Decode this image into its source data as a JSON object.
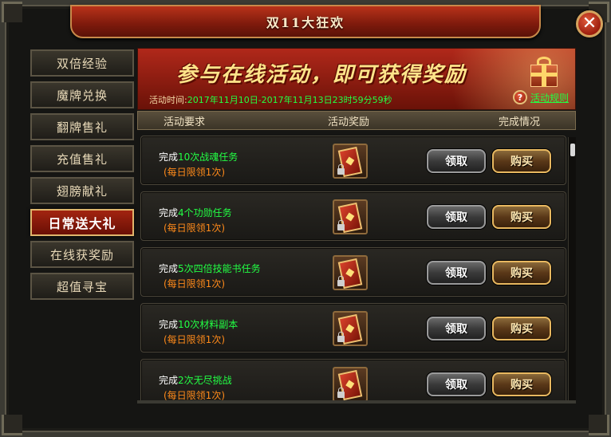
{
  "window": {
    "title": "双11大狂欢",
    "close_glyph": "✕"
  },
  "sidebar": {
    "items": [
      {
        "label": "双倍经验",
        "active": false
      },
      {
        "label": "魔牌兑换",
        "active": false
      },
      {
        "label": "翻牌售礼",
        "active": false
      },
      {
        "label": "充值售礼",
        "active": false
      },
      {
        "label": "翅膀献礼",
        "active": false
      },
      {
        "label": "日常送大礼",
        "active": true
      },
      {
        "label": "在线获奖励",
        "active": false
      },
      {
        "label": "超值寻宝",
        "active": false
      }
    ]
  },
  "banner": {
    "headline": "参与在线活动，即可获得奖励",
    "time_label": "活动时间:",
    "time_value": "2017年11月10日-2017年11月13日23时59分59秒",
    "rules_icon": "?",
    "rules_link": "活动规则",
    "icons": {
      "gift": "gift-box-icon",
      "help": "question-icon"
    }
  },
  "table": {
    "headers": {
      "requirement": "活动要求",
      "reward": "活动奖励",
      "status": "完成情况"
    }
  },
  "rows": [
    {
      "prefix": "完成",
      "task": "10次战魂任务",
      "suffix": "",
      "limit": "(每日限领1次)",
      "claim": "领取",
      "buy": "购买",
      "reward_icon": "card-pack-icon"
    },
    {
      "prefix": "完成",
      "task": "4个功勋任务",
      "suffix": "",
      "limit": "(每日限领1次)",
      "claim": "领取",
      "buy": "购买",
      "reward_icon": "card-pack-icon"
    },
    {
      "prefix": "完成",
      "task": "5次四倍技能书任务",
      "suffix": "",
      "limit": "(每日限领1次)",
      "claim": "领取",
      "buy": "购买",
      "reward_icon": "card-pack-icon"
    },
    {
      "prefix": "完成",
      "task": "10次材料副本",
      "suffix": "",
      "limit": "(每日限领1次)",
      "claim": "领取",
      "buy": "购买",
      "reward_icon": "card-pack-icon"
    },
    {
      "prefix": "完成",
      "task": "2次无尽挑战",
      "suffix": "",
      "limit": "(每日限领1次)",
      "claim": "领取",
      "buy": "购买",
      "reward_icon": "card-pack-icon"
    }
  ],
  "colors": {
    "accent_red": "#a22410",
    "highlight_green": "#22ff44",
    "limit_orange": "#ff8a1a",
    "gold_border": "#e0b56c"
  }
}
